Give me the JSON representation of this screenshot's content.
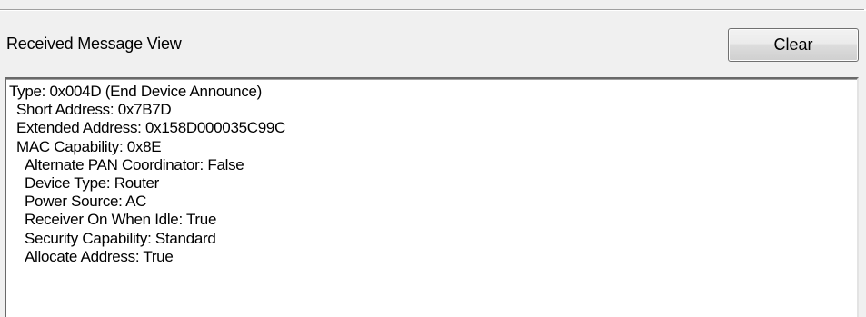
{
  "panel": {
    "title": "Received Message View",
    "clear_label": "Clear"
  },
  "message_view": {
    "lines": [
      {
        "level": 0,
        "text": "Type: 0x004D (End Device Announce)"
      },
      {
        "level": 1,
        "text": "Short Address: 0x7B7D"
      },
      {
        "level": 1,
        "text": "Extended Address: 0x158D000035C99C"
      },
      {
        "level": 1,
        "text": "MAC Capability: 0x8E"
      },
      {
        "level": 2,
        "text": "Alternate PAN Coordinator: False"
      },
      {
        "level": 2,
        "text": "Device Type: Router"
      },
      {
        "level": 2,
        "text": "Power Source: AC"
      },
      {
        "level": 2,
        "text": "Receiver On When Idle: True"
      },
      {
        "level": 2,
        "text": "Security Capability: Standard"
      },
      {
        "level": 2,
        "text": "Allocate Address: True"
      }
    ]
  }
}
